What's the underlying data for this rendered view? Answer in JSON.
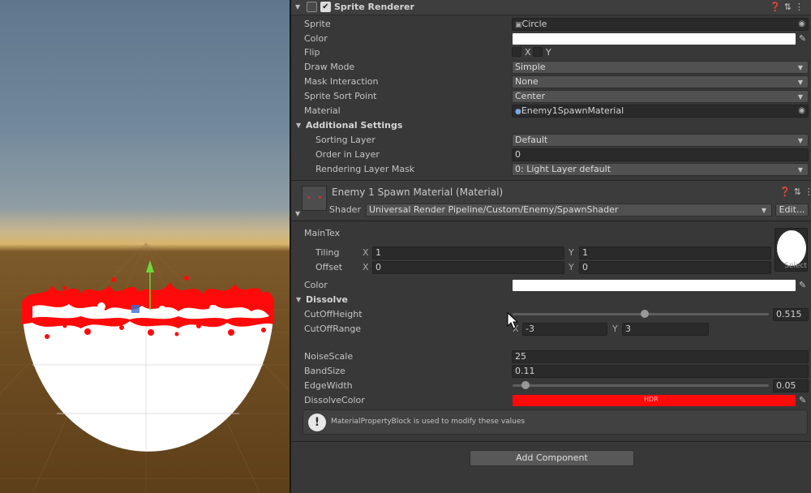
{
  "sprite_renderer": {
    "title": "Sprite Renderer",
    "enabled_check": "✔",
    "header_icons": [
      "help-icon",
      "presets-icon",
      "menu-icon"
    ]
  },
  "properties": {
    "sprite": {
      "label": "Sprite",
      "value": "Circle"
    },
    "color": {
      "label": "Color",
      "value": "#ffffff"
    },
    "flip": {
      "label": "Flip",
      "x": "X",
      "y": "Y"
    },
    "draw_mode": {
      "label": "Draw Mode",
      "value": "Simple"
    },
    "mask_interaction": {
      "label": "Mask Interaction",
      "value": "None"
    },
    "sprite_sort_point": {
      "label": "Sprite Sort Point",
      "value": "Center"
    },
    "material": {
      "label": "Material",
      "value": "Enemy1SpawnMaterial"
    }
  },
  "additional_settings": {
    "title": "Additional Settings",
    "sorting_layer": {
      "label": "Sorting Layer",
      "value": "Default"
    },
    "order_in_layer": {
      "label": "Order in Layer",
      "value": "0"
    },
    "rendering_layer_mask": {
      "label": "Rendering Layer Mask",
      "value": "0: Light Layer default"
    }
  },
  "material_panel": {
    "title": "Enemy 1 Spawn Material (Material)",
    "shader_label": "Shader",
    "shader_value": "Universal Render Pipeline/Custom/Enemy/SpawnShader",
    "edit_button": "Edit...",
    "main_tex_label": "MainTex",
    "select_label": "Select",
    "tiling": {
      "label": "Tiling",
      "x_label": "X",
      "x": "1",
      "y_label": "Y",
      "y": "1"
    },
    "offset": {
      "label": "Offset",
      "x_label": "X",
      "x": "0",
      "y_label": "Y",
      "y": "0"
    },
    "color_label": "Color"
  },
  "dissolve": {
    "title": "Dissolve",
    "cutoff_height": {
      "label": "CutOffHeight",
      "value": "0.515",
      "fraction": 0.515
    },
    "cutoff_range": {
      "label": "CutOffRange",
      "x_label": "X",
      "x": "-3",
      "y_label": "Y",
      "y": "3"
    },
    "noise_scale": {
      "label": "NoiseScale",
      "value": "25"
    },
    "band_size": {
      "label": "BandSize",
      "value": "0.11"
    },
    "edge_width": {
      "label": "EdgeWidth",
      "value": "0.05",
      "fraction": 0.05
    },
    "dissolve_color": {
      "label": "DissolveColor",
      "value": "#ff0a0a",
      "hdr_tag": "HDR"
    }
  },
  "help_box": {
    "text": "MaterialPropertyBlock is used to modify these values"
  },
  "add_component_label": "Add Component",
  "colors": {
    "accent_red": "#ff0a0a",
    "inspector_bg": "#383838",
    "field_bg": "#2a2a2a"
  }
}
